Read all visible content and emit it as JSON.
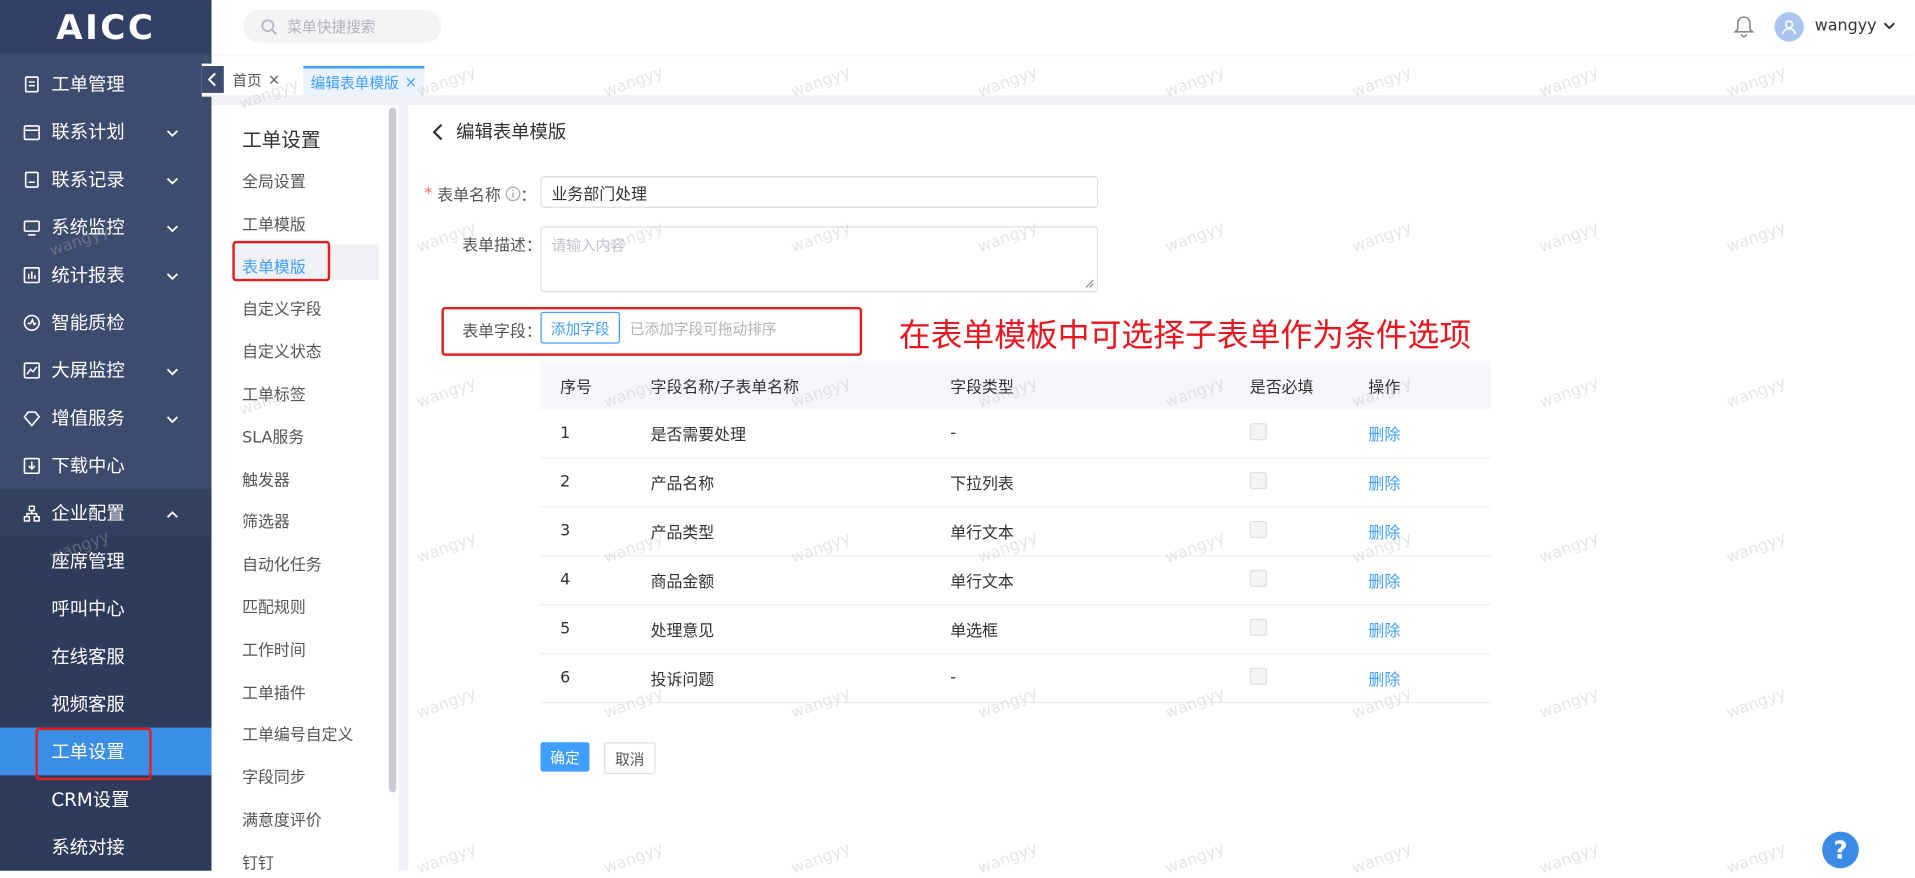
{
  "app": {
    "logo": "AICC"
  },
  "sidebar": {
    "items": [
      {
        "label": "工单管理",
        "icon": "clipboard-icon",
        "arrow": ""
      },
      {
        "label": "联系计划",
        "icon": "calendar-icon",
        "arrow": "chevron-down"
      },
      {
        "label": "联系记录",
        "icon": "record-icon",
        "arrow": "chevron-down"
      },
      {
        "label": "系统监控",
        "icon": "monitor-icon",
        "arrow": "chevron-down"
      },
      {
        "label": "统计报表",
        "icon": "report-icon",
        "arrow": "chevron-down"
      },
      {
        "label": "智能质检",
        "icon": "quality-icon",
        "arrow": ""
      },
      {
        "label": "大屏监控",
        "icon": "chart-icon",
        "arrow": "chevron-down"
      },
      {
        "label": "增值服务",
        "icon": "diamond-icon",
        "arrow": "chevron-down"
      },
      {
        "label": "下载中心",
        "icon": "download-icon",
        "arrow": ""
      },
      {
        "label": "企业配置",
        "icon": "org-icon",
        "arrow": "chevron-up"
      }
    ],
    "subitems": [
      "座席管理",
      "呼叫中心",
      "在线客服",
      "视频客服",
      "工单设置",
      "CRM设置",
      "系统对接"
    ],
    "active_sub": "工单设置"
  },
  "header": {
    "search_placeholder": "菜单快捷搜索",
    "username": "wangyy"
  },
  "tabs": [
    {
      "label": "首页",
      "close": "×"
    },
    {
      "label": "编辑表单模版",
      "close": "×"
    }
  ],
  "subnav": {
    "title": "工单设置",
    "items": [
      "全局设置",
      "工单模版",
      "表单模版",
      "自定义字段",
      "自定义状态",
      "工单标签",
      "SLA服务",
      "触发器",
      "筛选器",
      "自动化任务",
      "匹配规则",
      "工作时间",
      "工单插件",
      "工单编号自定义",
      "字段同步",
      "满意度评价",
      "钉钉"
    ],
    "active": "表单模版"
  },
  "page": {
    "title": "编辑表单模版",
    "form": {
      "name_label": "表单名称",
      "name_required": "*",
      "name_colon": "：",
      "name_value": "业务部门处理",
      "desc_label": "表单描述：",
      "desc_placeholder": "请输入内容",
      "fields_label": "表单字段：",
      "add_field_button": "添加字段",
      "add_field_hint": "已添加字段可拖动排序"
    },
    "annotation": "在表单模板中可选择子表单作为条件选项",
    "table": {
      "headers": [
        "序号",
        "字段名称/子表单名称",
        "字段类型",
        "是否必填",
        "操作"
      ],
      "rows": [
        {
          "no": "1",
          "name": "是否需要处理",
          "type": "-",
          "required": false,
          "action": "删除"
        },
        {
          "no": "2",
          "name": "产品名称",
          "type": "下拉列表",
          "required": false,
          "action": "删除"
        },
        {
          "no": "3",
          "name": "产品类型",
          "type": "单行文本",
          "required": false,
          "action": "删除"
        },
        {
          "no": "4",
          "name": "商品金额",
          "type": "单行文本",
          "required": false,
          "action": "删除"
        },
        {
          "no": "5",
          "name": "处理意见",
          "type": "单选框",
          "required": false,
          "action": "删除"
        },
        {
          "no": "6",
          "name": "投诉问题",
          "type": "-",
          "required": false,
          "action": "删除"
        }
      ]
    },
    "confirm_button": "确定",
    "cancel_button": "取消",
    "help": "?"
  },
  "watermark": "wangyy",
  "colors": {
    "sidebar_bg": "#3d4b6e",
    "active_blue": "#409eff",
    "annotation_red": "#e8141e"
  }
}
